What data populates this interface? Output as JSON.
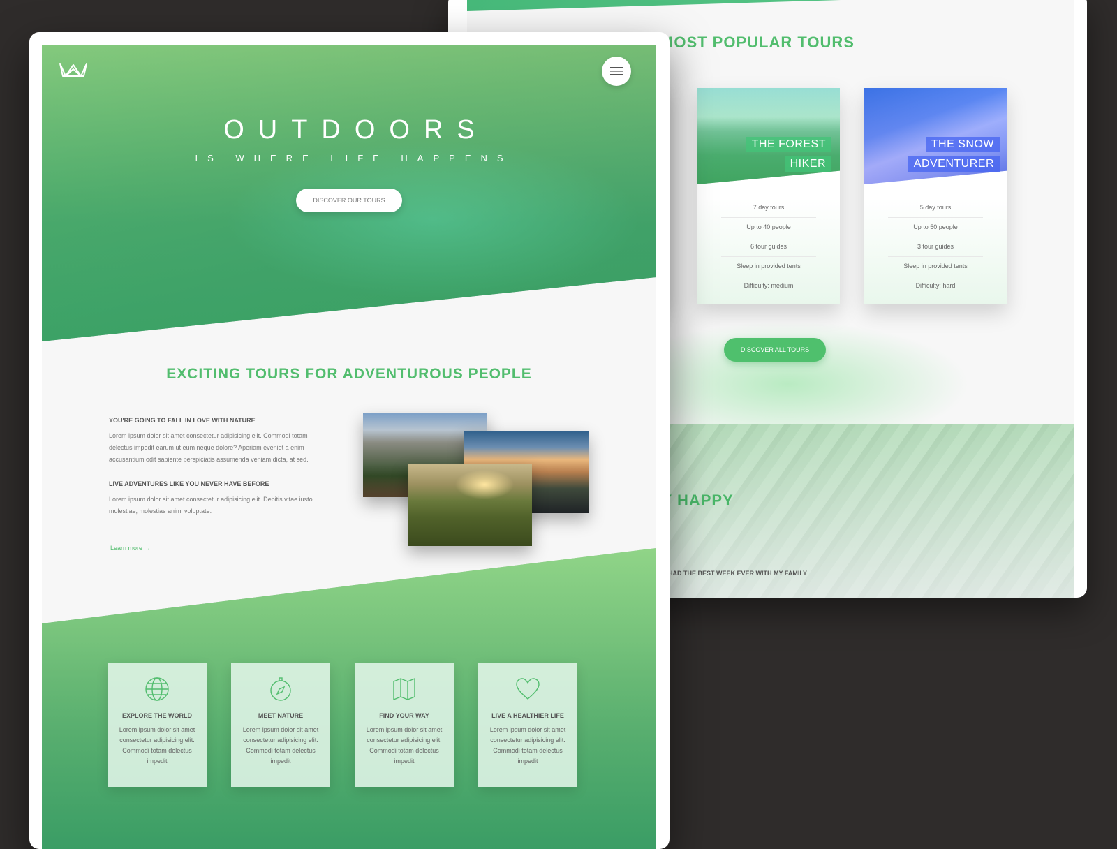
{
  "back_page": {
    "section_title": "MOST POPULAR TOURS",
    "cards": [
      {
        "title_lines": [
          "THE FOREST",
          "HIKER"
        ],
        "details": [
          "7 day tours",
          "Up to 40 people",
          "6 tour guides",
          "Sleep in provided tents",
          "Difficulty: medium"
        ]
      },
      {
        "title_lines": [
          "THE SNOW",
          "ADVENTURER"
        ],
        "details": [
          "5 day tours",
          "Up to 50 people",
          "3 tour guides",
          "Sleep in provided tents",
          "Difficulty: hard"
        ]
      }
    ],
    "cta_label": "DISCOVER ALL TOURS",
    "stories_title": "AKE PEOPLE GENUINELY HAPPY",
    "testimonial_heading": "I HAD THE BEST WEEK EVER WITH MY FAMILY"
  },
  "front_page": {
    "logo_icon": "crown-icon",
    "menu_icon": "hamburger-icon",
    "hero": {
      "title": "OUTDOORS",
      "subtitle": "IS WHERE LIFE HAPPENS",
      "cta_label": "DISCOVER OUR TOURS"
    },
    "about": {
      "title": "EXCITING TOURS FOR ADVENTUROUS PEOPLE",
      "blocks": [
        {
          "heading": "YOU'RE GOING TO FALL IN LOVE WITH NATURE",
          "text": "Lorem ipsum dolor sit amet consectetur adipisicing elit. Commodi totam delectus impedit earum ut eum neque dolore? Aperiam eveniet a enim accusantium odit sapiente perspiciatis assumenda veniam dicta, at sed."
        },
        {
          "heading": "LIVE ADVENTURES LIKE YOU NEVER HAVE BEFORE",
          "text": "Lorem ipsum dolor sit amet consectetur adipisicing elit. Debitis vitae iusto molestiae, molestias animi voluptate."
        }
      ],
      "link_label": "Learn more →"
    },
    "features": [
      {
        "icon": "globe-icon",
        "title": "EXPLORE THE WORLD",
        "text": "Lorem ipsum dolor sit amet consectetur adipisicing elit. Commodi totam delectus impedit"
      },
      {
        "icon": "compass-icon",
        "title": "MEET NATURE",
        "text": "Lorem ipsum dolor sit amet consectetur adipisicing elit. Commodi totam delectus impedit"
      },
      {
        "icon": "map-icon",
        "title": "FIND YOUR WAY",
        "text": "Lorem ipsum dolor sit amet consectetur adipisicing elit. Commodi totam delectus impedit"
      },
      {
        "icon": "heart-icon",
        "title": "LIVE A HEALTHIER LIFE",
        "text": "Lorem ipsum dolor sit amet consectetur adipisicing elit. Commodi totam delectus impedit"
      }
    ]
  },
  "colors": {
    "accent_green": "#52bd6e",
    "snow_blue": "#4664f0",
    "backdrop": "#2f2c2b"
  }
}
